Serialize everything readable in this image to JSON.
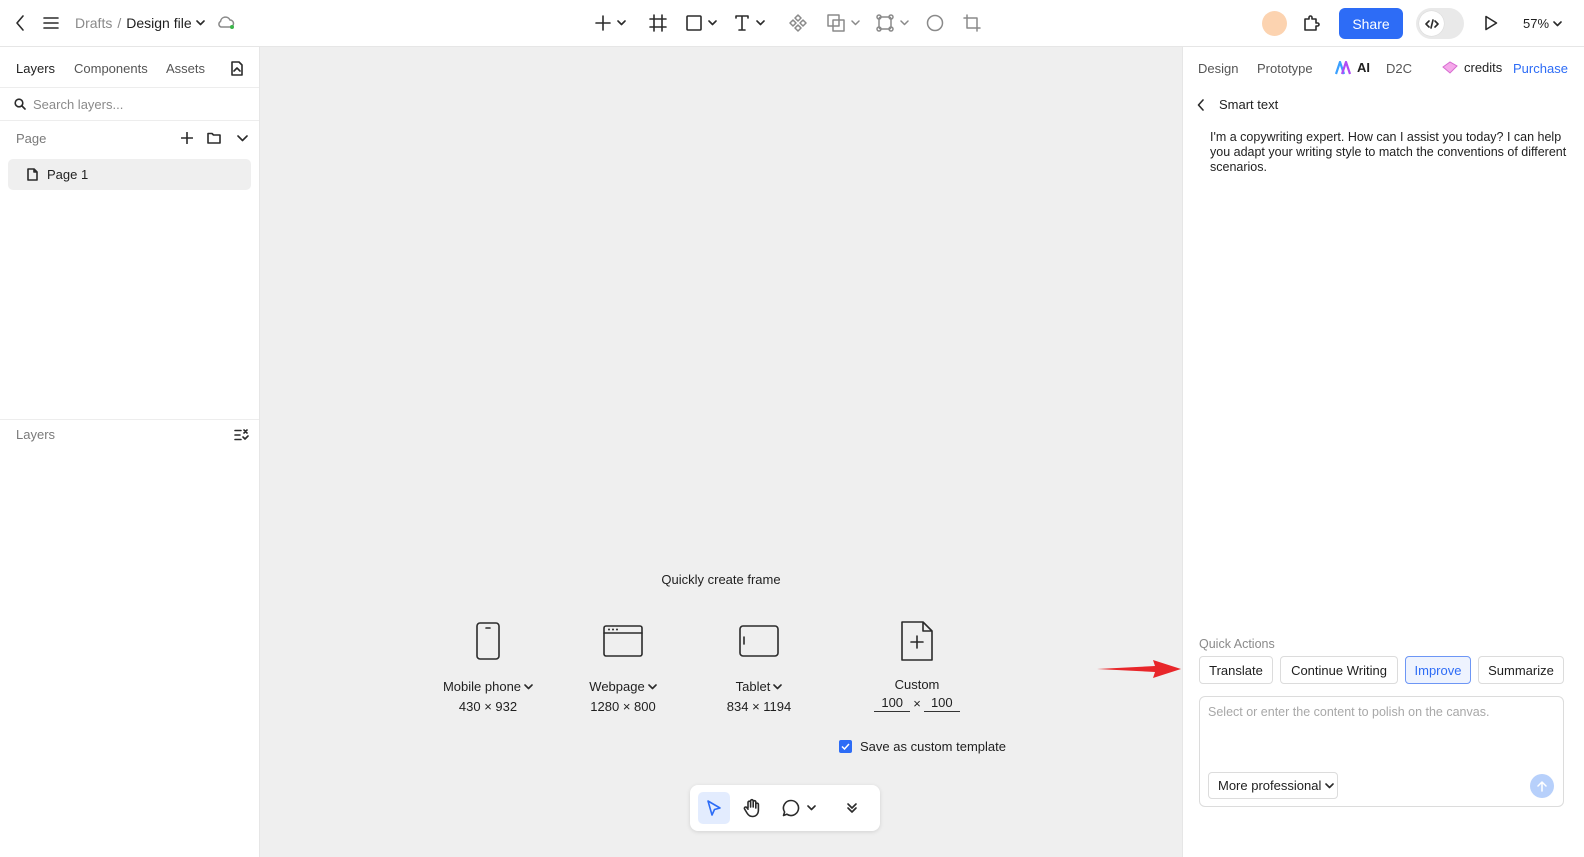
{
  "topbar": {
    "breadcrumb_root": "Drafts",
    "breadcrumb_sep": "/",
    "file_name": "Design file",
    "share_label": "Share",
    "zoom": "57%"
  },
  "left_panel": {
    "tabs": [
      "Layers",
      "Components",
      "Assets"
    ],
    "search_placeholder": "Search layers...",
    "page_section": "Page",
    "pages": [
      "Page 1"
    ],
    "layers_section": "Layers"
  },
  "canvas": {
    "quick_create_title": "Quickly create frame",
    "frames": [
      {
        "name": "Mobile phone",
        "size": "430 × 932"
      },
      {
        "name": "Webpage",
        "size": "1280 × 800"
      },
      {
        "name": "Tablet",
        "size": "834 × 1194"
      }
    ],
    "custom": {
      "name": "Custom",
      "width": "100",
      "sep": "×",
      "height": "100"
    },
    "save_template_label": "Save as custom template"
  },
  "right_panel": {
    "tabs": [
      "Design",
      "Prototype",
      "AI",
      "D2C"
    ],
    "credits_label": "credits",
    "purchase_label": "Purchase",
    "smart_text_title": "Smart text",
    "ai_message": "I'm a copywriting expert. How can I assist you today? I can help you adapt your writing style to match the conventions of different scenarios.",
    "quick_actions_label": "Quick Actions",
    "quick_actions": [
      "Translate",
      "Continue Writing",
      "Improve",
      "Summarize"
    ],
    "prompt_placeholder": "Select or enter the content to polish on the canvas.",
    "tone_value": "More professional"
  },
  "colors": {
    "accent": "#2d6cf6",
    "canvas_bg": "#efefef",
    "arrow": "#e8262a"
  }
}
